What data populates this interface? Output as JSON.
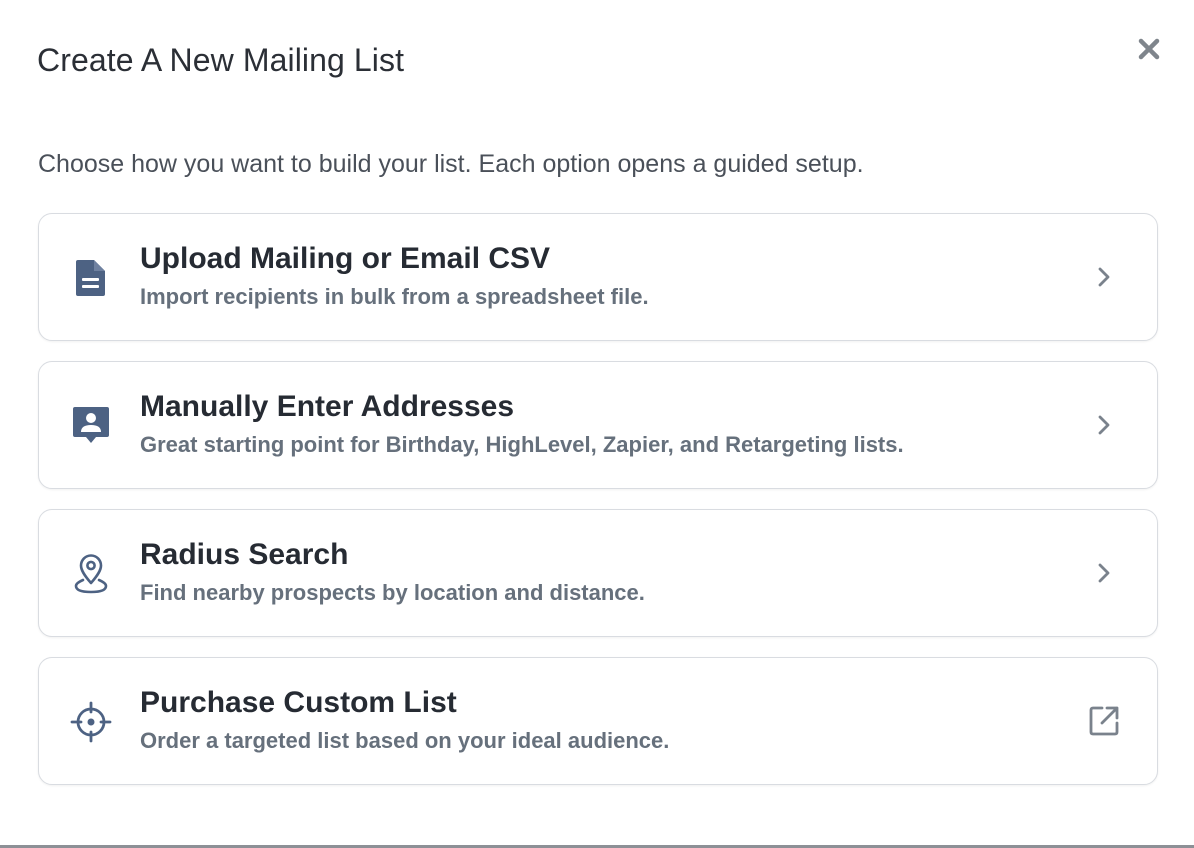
{
  "modal": {
    "title": "Create A New Mailing List",
    "close_icon": "close-icon",
    "intro": "Choose how you want to build your list. Each option opens a guided setup."
  },
  "options": [
    {
      "title": "Upload Mailing or Email CSV",
      "description": "Import recipients in bulk from a spreadsheet file.",
      "icon": "document-icon",
      "action_icon": "chevron-right-icon"
    },
    {
      "title": "Manually Enter Addresses",
      "description": "Great starting point for Birthday, HighLevel, Zapier, and Retargeting lists.",
      "icon": "contact-card-icon",
      "action_icon": "chevron-right-icon"
    },
    {
      "title": "Radius Search",
      "description": "Find nearby prospects by location and distance.",
      "icon": "location-pin-icon",
      "action_icon": "chevron-right-icon"
    },
    {
      "title": "Purchase Custom List",
      "description": "Order a targeted list based on your ideal audience.",
      "icon": "crosshair-icon",
      "action_icon": "external-link-icon"
    }
  ],
  "colors": {
    "icon": "#4d6283",
    "action": "#7a828c",
    "title": "#262b33",
    "description": "#66707c",
    "card_border": "#d9dce1"
  }
}
